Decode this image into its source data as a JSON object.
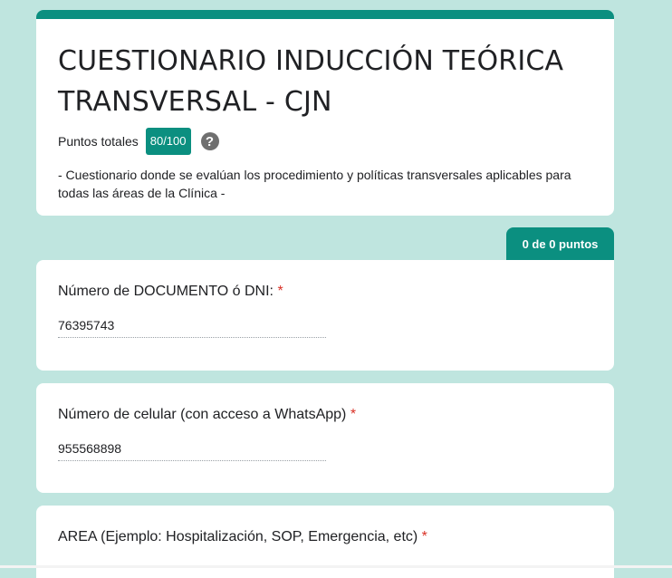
{
  "header": {
    "title": "CUESTIONARIO INDUCCIÓN TEÓRICA TRANSVERSAL - CJN",
    "points_label": "Puntos totales",
    "points_value": "80/100",
    "help_icon": "help-circle-icon",
    "description": "- Cuestionario donde se evalúan los procedimiento y políticas transversales aplicables para todas las áreas de la Clínica -"
  },
  "score_tab": "0 de 0 puntos",
  "questions": [
    {
      "title": "Número de DOCUMENTO ó DNI:",
      "required": "*",
      "answer": "76395743"
    },
    {
      "title": "Número de celular (con acceso a WhatsApp)",
      "required": "*",
      "answer": "955568898"
    },
    {
      "title": "AREA (Ejemplo: Hospitalización, SOP, Emergencia, etc)",
      "required": "*"
    }
  ],
  "colors": {
    "accent": "#0b8f80",
    "background": "#bfe5df",
    "required": "#d93025"
  }
}
